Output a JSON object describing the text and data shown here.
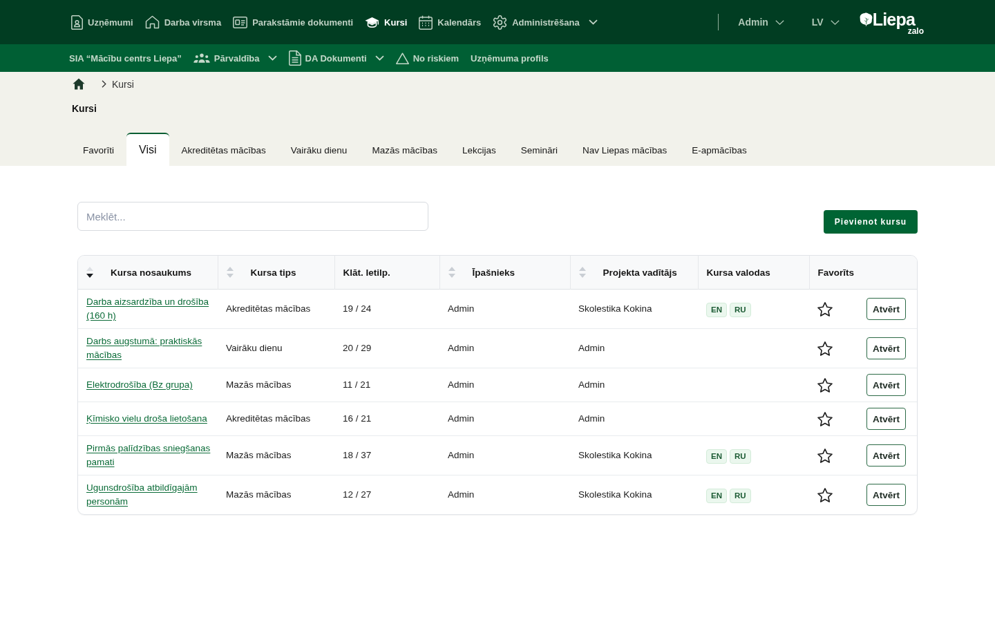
{
  "top_nav": {
    "items": [
      {
        "label": "Uzņēmumi",
        "selected": false,
        "dropdown": false
      },
      {
        "label": "Darba virsma",
        "selected": false,
        "dropdown": false
      },
      {
        "label": "Parakstāmie dokumenti",
        "selected": false,
        "dropdown": false
      },
      {
        "label": "Kursi",
        "selected": true,
        "dropdown": false
      },
      {
        "label": "Kalendārs",
        "selected": false,
        "dropdown": false
      },
      {
        "label": "Administrēšana",
        "selected": false,
        "dropdown": true
      }
    ],
    "user_menu": {
      "label": "Admin"
    },
    "language_menu": {
      "label": "LV"
    },
    "logo": {
      "name": "Liepa",
      "tagline": "zalo"
    }
  },
  "sub_nav": {
    "company": "SIA “Mācību centrs Liepa”",
    "items": [
      {
        "label": "Pārvaldība",
        "dropdown": true
      },
      {
        "label": "DA Dokumenti",
        "dropdown": true
      },
      {
        "label": "No riskiem",
        "dropdown": false
      },
      {
        "label": "Uzņēmuma profils",
        "dropdown": false
      }
    ]
  },
  "breadcrumb": [
    "Kursi"
  ],
  "page_title": "Kursi",
  "tabs": [
    {
      "label": "Favorīti",
      "selected": false
    },
    {
      "label": "Visi",
      "selected": true
    },
    {
      "label": "Akreditētas mācības",
      "selected": false
    },
    {
      "label": "Vairāku dienu",
      "selected": false
    },
    {
      "label": "Mazās mācības",
      "selected": false
    },
    {
      "label": "Lekcijas",
      "selected": false
    },
    {
      "label": "Semināri",
      "selected": false
    },
    {
      "label": "Nav Liepas mācības",
      "selected": false
    },
    {
      "label": "E-apmācības",
      "selected": false
    }
  ],
  "search": {
    "placeholder": "Meklēt..."
  },
  "add_button": "Pievienot kursu",
  "table": {
    "columns": [
      {
        "label": "Kursa nosaukums",
        "sortable": true,
        "sorted": true
      },
      {
        "label": "Kursa tips",
        "sortable": true,
        "sorted": false
      },
      {
        "label": "Klāt. Ietilp.",
        "sortable": false
      },
      {
        "label": "Īpašnieks",
        "sortable": true,
        "sorted": false
      },
      {
        "label": "Projekta vadītājs",
        "sortable": true,
        "sorted": false
      },
      {
        "label": "Kursa valodas",
        "sortable": false
      },
      {
        "label": "Favorīts",
        "sortable": false
      }
    ],
    "rows": [
      {
        "name": "Darba aizsardzība un drošība (160 h)",
        "type": "Akreditētas mācības",
        "capacity": "19 / 24",
        "owner": "Admin",
        "project_manager": "Skolestika Kokina",
        "languages": [
          "EN",
          "RU"
        ],
        "favorite": false,
        "action": "Atvērt"
      },
      {
        "name": "Darbs augstumā: praktiskās mācības",
        "type": "Vairāku dienu",
        "capacity": "20 / 29",
        "owner": "Admin",
        "project_manager": "Admin",
        "favorite": false,
        "action": "Atvērt"
      },
      {
        "name": "Elektrodrošība (Bz grupa)",
        "type": "Mazās mācības",
        "capacity": "11 / 21",
        "owner": "Admin",
        "project_manager": "Admin",
        "favorite": false,
        "action": "Atvērt"
      },
      {
        "name": "Ķīmisko vielu droša lietošana",
        "type": "Akreditētas mācības",
        "capacity": "16 / 21",
        "owner": "Admin",
        "project_manager": "Admin",
        "favorite": false,
        "action": "Atvērt"
      },
      {
        "name": "Pirmās palīdzības sniegšanas pamati",
        "type": "Mazās mācības",
        "capacity": "18 / 37",
        "owner": "Admin",
        "project_manager": "Skolestika Kokina",
        "languages": [
          "EN",
          "RU"
        ],
        "favorite": false,
        "action": "Atvērt"
      },
      {
        "name": "Ugunsdrošība atbildīgajām personām",
        "type": "Mazās mācības",
        "capacity": "12 / 27",
        "owner": "Admin",
        "project_manager": "Skolestika Kokina",
        "languages": [
          "EN",
          "RU"
        ],
        "favorite": false,
        "action": "Atvērt"
      }
    ]
  }
}
